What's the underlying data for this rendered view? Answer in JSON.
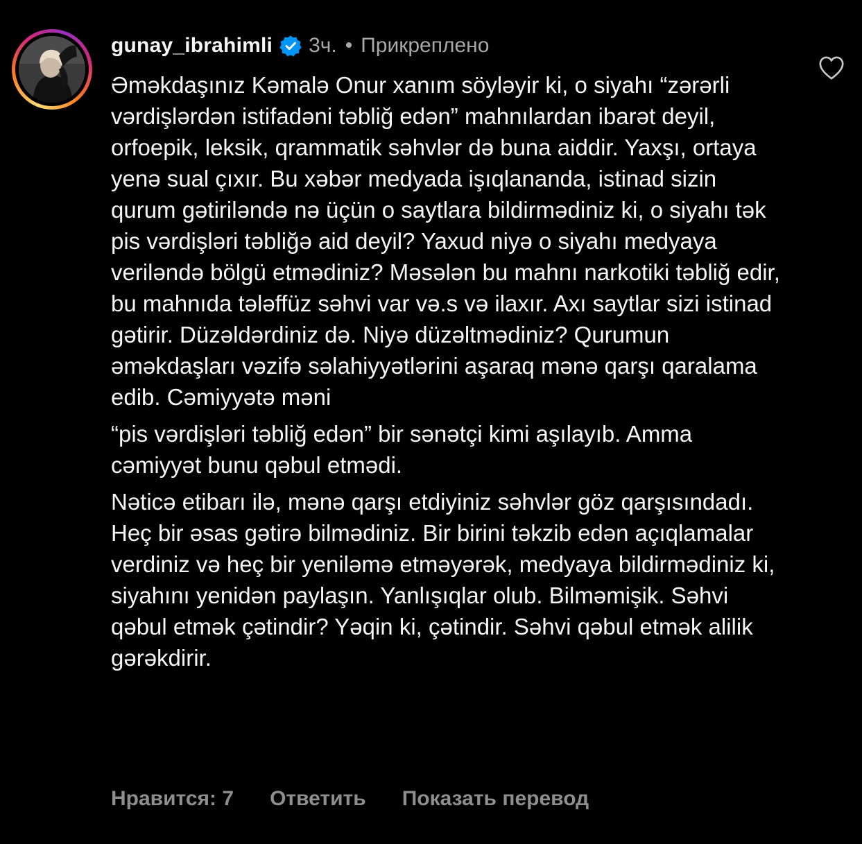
{
  "comment": {
    "username": "gunay_ibrahimli",
    "verified": true,
    "time": "3ч.",
    "separator": "•",
    "pinned_label": "Прикреплено",
    "paragraphs": [
      "Əməkdaşınız Kəmalə Onur xanım söyləyir ki, o siyahı “zərərli vərdişlərdən istifadəni təbliğ edən” mahnılardan ibarət deyil, orfoepik, leksik, qrammatik səhvlər də buna aiddir. Yaxşı, ortaya yenə sual çıxır. Bu xəbər medyada işıqlananda, istinad sizin qurum gətiriləndə nə üçün o saytlara bildirmədiniz ki, o siyahı tək  pis vərdişləri təbliğə aid deyil? Yaxud niyə o siyahı medyaya  veriləndə bölgü etmədiniz? Məsələn bu mahnı narkotiki təbliğ edir, bu mahnıda tələffüz səhvi var və.s və ilaxır. Axı saytlar sizi istinad gətirir. Düzəldərdiniz də. Niyə düzəltmədiniz? Qurumun əməkdaşları vəzifə səlahiyyətlərini aşaraq mənə qarşı qaralama edib. Cəmiyyətə məni",
      "“pis vərdişləri təbliğ edən” bir sənətçi kimi aşılayıb. Amma cəmiyyət bunu qəbul etmədi.",
      "Nəticə etibarı ilə, mənə qarşı etdiyiniz səhvlər göz qarşısındadı. Heç bir əsas gətirə bilmədiniz. Bir birini təkzib edən açıqlamalar verdiniz və heç bir yeniləmə etməyərək, medyaya bildirmədiniz ki, siyahını yenidən paylaşın. Yanlışıqlar olub. Bilməmişik. Səhvi qəbul etmək çətindir? Yəqin ki, çətindir. Səhvi qəbul etmək alilik gərəkdirir."
    ],
    "likes_label": "Нравится: 7",
    "reply_label": "Ответить",
    "translate_label": "Показать перевод",
    "icons": {
      "verified": "verified-badge-icon",
      "like": "heart-icon"
    },
    "colors": {
      "background": "#000000",
      "text": "#f5f5f5",
      "meta": "#a8a8a8",
      "actions": "#8e8e8e",
      "verified": "#0095f6"
    }
  }
}
